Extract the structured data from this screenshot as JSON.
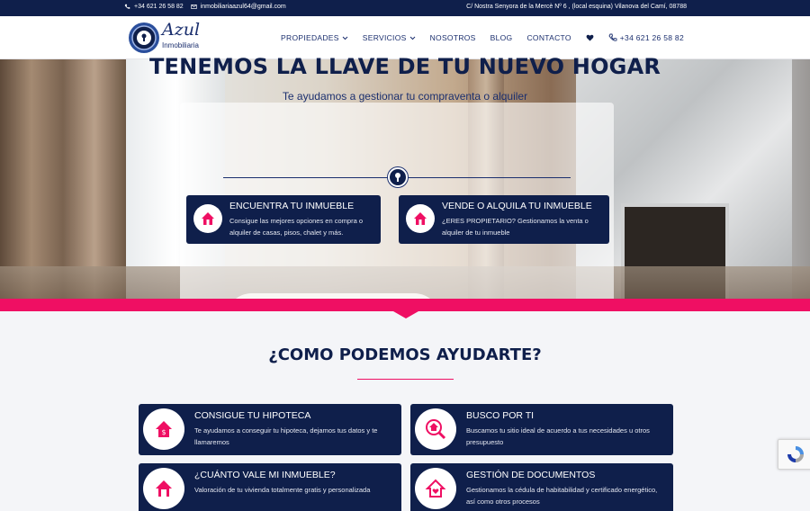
{
  "topbar": {
    "phone": "+34 621 26 58 82",
    "email": "inmobiliariaazul64@gmail.com",
    "address": "C/ Nostra Senyora de la Mercè Nº 6 , (local esquina) Vilanova del Camí, 08788"
  },
  "logo": {
    "name": "Azul",
    "sub": "Inmobiliaria"
  },
  "nav": {
    "items": [
      {
        "label": "PROPIEDADES"
      },
      {
        "label": "SERVICIOS"
      },
      {
        "label": "NOSOTROS"
      },
      {
        "label": "BLOG"
      },
      {
        "label": "CONTACTO"
      }
    ],
    "phone": "+34 621 26 58 82"
  },
  "hero": {
    "title": "TENEMOS LA LLAVE DE TU NUEVO HOGAR",
    "subtitle": "Te ayudamos a gestionar tu compraventa o alquiler",
    "cards": [
      {
        "title": "ENCUENTRA TU INMUEBLE",
        "text": "Consigue las mejores opciones en compra o alquiler de casas, pisos, chalet y más."
      },
      {
        "title": "VENDE O ALQUILA TU INMUEBLE",
        "text": "¿ERES PROPIETARIO? Gestionamos la venta o alquiler de tu inmueble"
      }
    ]
  },
  "section": {
    "title": "¿COMO PODEMOS AYUDARTE?",
    "cards": [
      {
        "title": "CONSIGUE TU HIPOTECA",
        "text": "Te ayudamos a conseguir tu hipoteca, dejamos tus datos y te llamaremos"
      },
      {
        "title": "BUSCO POR TI",
        "text": "Buscamos tu sitio ideal de acuerdo a tus necesidades u otros presupuesto"
      },
      {
        "title": "¿CUÁNTO VALE MI INMUEBLE?",
        "text": "Valoración de tu vivienda totalmente gratis y personalizada"
      },
      {
        "title": "GESTIÓN DE DOCUMENTOS",
        "text": "Gestionamos la cédula de habitabilidad y certificado energético, así como otros procesos"
      }
    ]
  },
  "colors": {
    "navy": "#0f1f4b",
    "pink": "#ef0f63"
  }
}
